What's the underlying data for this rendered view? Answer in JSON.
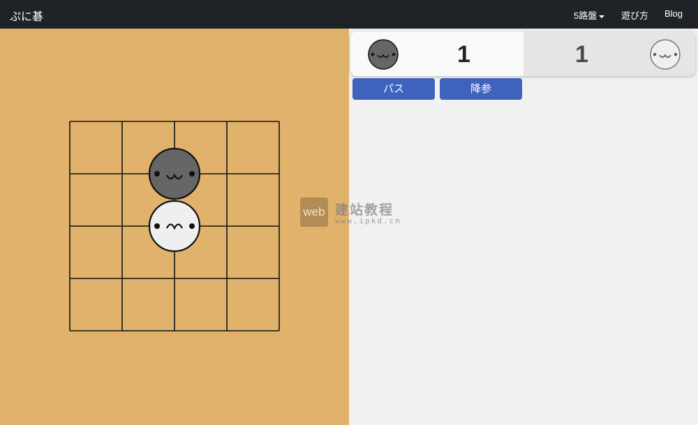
{
  "navbar": {
    "brand": "ぷに碁",
    "board_size": "5路盤",
    "howto": "遊び方",
    "blog": "Blog"
  },
  "score": {
    "black": "1",
    "white": "1"
  },
  "buttons": {
    "pass": "パス",
    "resign": "降参"
  },
  "board": {
    "size": 5,
    "stones": [
      {
        "color": "black",
        "col": 2,
        "row": 1,
        "face": "smile"
      },
      {
        "color": "white",
        "col": 2,
        "row": 2,
        "face": "content"
      }
    ]
  },
  "watermark": {
    "logo": "web",
    "name": "建站教程",
    "url": "www.ipkd.cn"
  },
  "colors": {
    "board": "#e0b26c",
    "black_stone": "#666666",
    "white_stone": "#efefef",
    "button": "#3f62bd",
    "navbar": "#1f2328"
  }
}
